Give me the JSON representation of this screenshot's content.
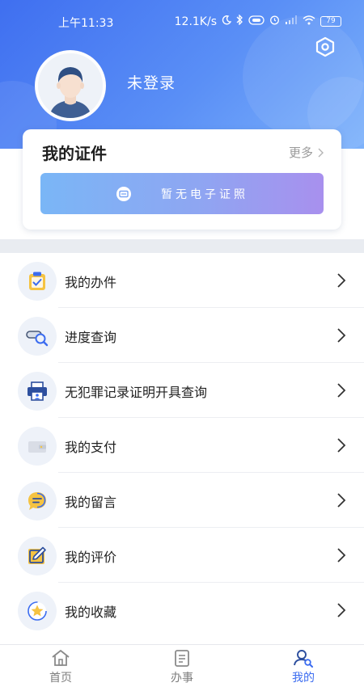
{
  "status_bar": {
    "time": "上午11:33",
    "network_speed": "12.1K/s",
    "battery": "79",
    "icons": [
      "moon-icon",
      "bluetooth-icon",
      "hd-icon",
      "alarm-icon",
      "signal-icon",
      "wifi-icon",
      "battery-icon"
    ]
  },
  "header": {
    "login_status": "未登录",
    "settings_icon": "settings-hexagon-icon"
  },
  "certificates": {
    "title": "我的证件",
    "more_label": "更多",
    "empty_text": "暂无电子证照"
  },
  "menu": {
    "items": [
      {
        "label": "我的办件",
        "icon": "clipboard-check-icon"
      },
      {
        "label": "进度查询",
        "icon": "progress-search-icon"
      },
      {
        "label": "无犯罪记录证明开具查询",
        "icon": "printer-id-icon"
      },
      {
        "label": "我的支付",
        "icon": "wallet-icon"
      },
      {
        "label": "我的留言",
        "icon": "chat-bubble-icon"
      },
      {
        "label": "我的评价",
        "icon": "edit-note-icon"
      },
      {
        "label": "我的收藏",
        "icon": "star-icon"
      }
    ]
  },
  "tabbar": {
    "tabs": [
      {
        "label": "首页",
        "icon": "home-icon"
      },
      {
        "label": "办事",
        "icon": "document-icon"
      },
      {
        "label": "我的",
        "icon": "user-search-icon"
      }
    ],
    "active_tab": "我的"
  },
  "colors": {
    "primary": "#3b6cf0",
    "header_gradient_start": "#3f6ff0",
    "header_gradient_end": "#7db2fb",
    "accent_yellow": "#f5c342"
  }
}
